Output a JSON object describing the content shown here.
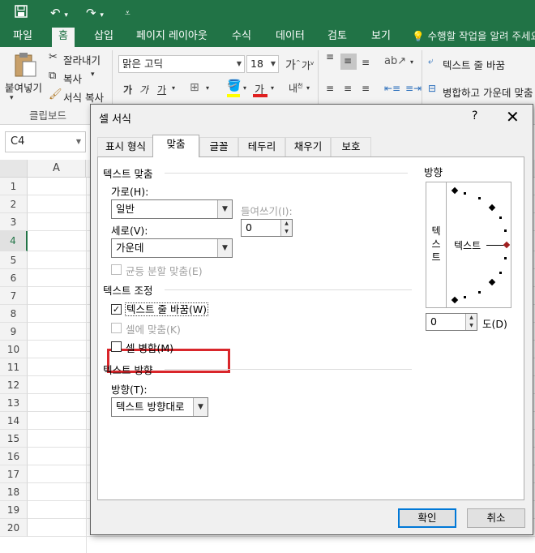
{
  "qat": {
    "save_icon": "save-icon",
    "undo_icon": "undo-icon",
    "redo_icon": "redo-icon"
  },
  "tabs": [
    "파일",
    "홈",
    "삽입",
    "페이지 레이아웃",
    "수식",
    "데이터",
    "검토",
    "보기"
  ],
  "active_tab": "홈",
  "tell_me": "수행할 작업을 알려 주세요",
  "ribbon": {
    "paste_label": "붙여넣기",
    "cut_label": "잘라내기",
    "copy_label": "복사",
    "format_painter_label": "서식 복사",
    "clipboard_group": "클립보드",
    "font_name": "맑은 고딕",
    "font_size": "18",
    "wrap_text_label": "텍스트 줄 바꿈",
    "merge_center_label": "병합하고 가운데 맞춤"
  },
  "name_box": "C4",
  "grid": {
    "column_header": "A",
    "rows": [
      "1",
      "2",
      "3",
      "4",
      "5",
      "6",
      "7",
      "8",
      "9",
      "10",
      "11",
      "12",
      "13",
      "14",
      "15",
      "16",
      "17",
      "18",
      "19",
      "20"
    ],
    "active_row": "4"
  },
  "dialog": {
    "title": "셀 서식",
    "help": "?",
    "tabs": [
      "표시 형식",
      "맞춤",
      "글꼴",
      "테두리",
      "채우기",
      "보호"
    ],
    "active_tab": "맞춤",
    "text_alignment_header": "텍스트 맞춤",
    "horizontal_label": "가로(H):",
    "horizontal_value": "일반",
    "indent_label": "들여쓰기(I):",
    "indent_value": "0",
    "vertical_label": "세로(V):",
    "vertical_value": "가운데",
    "justify_distributed_label": "균등 분할 맞춤(E)",
    "text_control_header": "텍스트 조정",
    "wrap_text_label": "텍스트 줄 바꿈(W)",
    "wrap_text_checked": true,
    "shrink_to_fit_label": "셀에 맞춤(K)",
    "merge_cells_label": "셀 병합(M)",
    "merge_cells_checked": false,
    "text_direction_header": "텍스트 방향",
    "direction_label": "방향(T):",
    "direction_value": "텍스트 방향대로",
    "orientation_header": "방향",
    "orientation_vertical_text": [
      "텍",
      "스",
      "트"
    ],
    "orientation_text": "텍스트",
    "degrees_value": "0",
    "degrees_label": "도(D)",
    "ok_label": "확인",
    "cancel_label": "취소"
  },
  "colors": {
    "excel_green": "#217346",
    "highlight_red": "#d9262b",
    "focus_blue": "#0078d7"
  }
}
